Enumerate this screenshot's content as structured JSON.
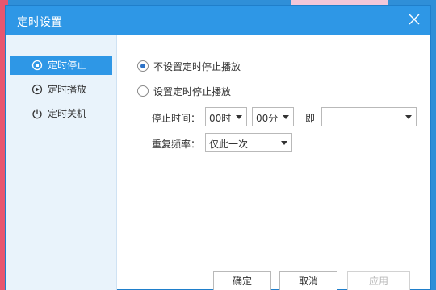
{
  "window": {
    "title": "定时设置",
    "close_icon": "close-icon"
  },
  "sidebar": {
    "items": [
      {
        "label": "定时停止",
        "icon": "stop-clock-icon",
        "active": true
      },
      {
        "label": "定时播放",
        "icon": "play-clock-icon",
        "active": false
      },
      {
        "label": "定时关机",
        "icon": "power-icon",
        "active": false
      }
    ]
  },
  "options": {
    "no_stop": {
      "label": "不设置定时停止播放",
      "checked": true
    },
    "set_stop": {
      "label": "设置定时停止播放",
      "checked": false
    }
  },
  "stop_time": {
    "label": "停止时间：",
    "hour": "00时",
    "minute": "00分",
    "sep_label": "即",
    "result": ""
  },
  "repeat": {
    "label": "重复频率：",
    "value": "仅此一次"
  },
  "buttons": {
    "ok": "确定",
    "cancel": "取消",
    "apply": "应用"
  },
  "colors": {
    "accent": "#2e97e6",
    "sidebar_bg": "#e9f3fb",
    "radio_dot": "#2e73c7"
  }
}
